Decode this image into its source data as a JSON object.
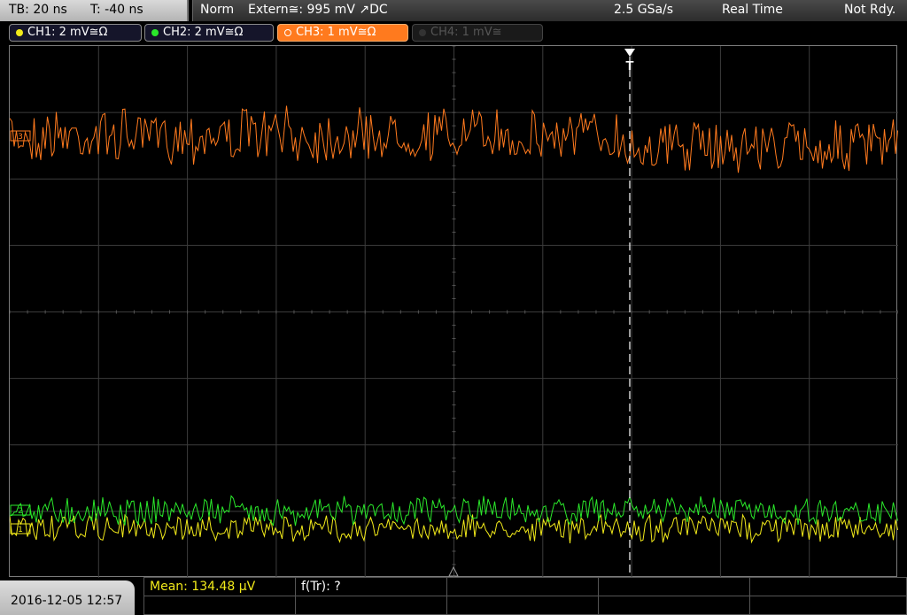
{
  "timebase": {
    "tb": "TB: 20 ns",
    "trigger_pos": "T: -40 ns"
  },
  "status": {
    "mode": "Norm",
    "trigger_source": "Extern≅: 995 mV ↗DC",
    "sample_rate": "2.5 GSa/s",
    "acq_mode": "Real Time",
    "state": "Not Rdy."
  },
  "channels": [
    {
      "label": "CH1: 2 mV≅Ω",
      "color": "#f2ea1a",
      "active": true
    },
    {
      "label": "CH2: 2 mV≅Ω",
      "color": "#2ae82a",
      "active": true
    },
    {
      "label": "CH3: 1 mV≅Ω",
      "color": "#ff7a1e",
      "active": true,
      "selected": true
    },
    {
      "label": "CH4: 1 mV≅",
      "color": "#555555",
      "active": false
    }
  ],
  "trigger_marker": {
    "label": "T"
  },
  "markers": {
    "ch3": "3",
    "ch2": "2",
    "ch1": "1"
  },
  "datetime": "2016-12-05 12:57",
  "measurements": {
    "mean": "Mean: 134.48 µV",
    "freq": "f(Tr): ?"
  }
}
